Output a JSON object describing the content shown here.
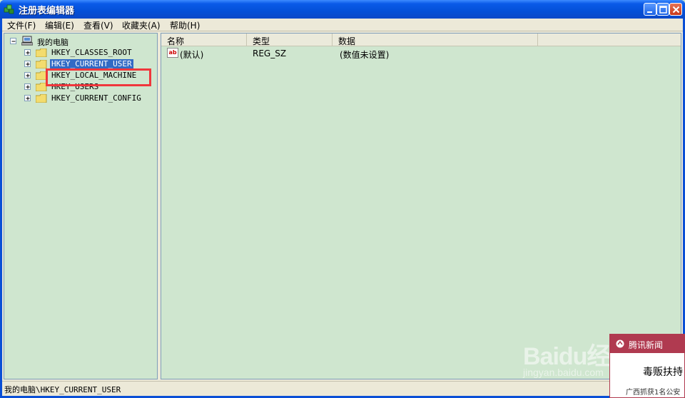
{
  "window": {
    "title": "注册表编辑器"
  },
  "menubar": {
    "items": [
      {
        "label": "文件(F)"
      },
      {
        "label": "编辑(E)"
      },
      {
        "label": "查看(V)"
      },
      {
        "label": "收藏夹(A)"
      },
      {
        "label": "帮助(H)"
      }
    ]
  },
  "tree": {
    "root": "我的电脑",
    "items": [
      {
        "label": "HKEY_CLASSES_ROOT"
      },
      {
        "label": "HKEY_CURRENT_USER",
        "selected": true
      },
      {
        "label": "HKEY_LOCAL_MACHINE"
      },
      {
        "label": "HKEY_USERS"
      },
      {
        "label": "HKEY_CURRENT_CONFIG"
      }
    ]
  },
  "list": {
    "columns": [
      "名称",
      "类型",
      "数据"
    ],
    "rows": [
      {
        "name": "(默认)",
        "type": "REG_SZ",
        "data": "(数值未设置)",
        "icon": "string-value-icon"
      }
    ]
  },
  "statusbar": {
    "path": "我的电脑\\HKEY_CURRENT_USER"
  },
  "news": {
    "header": "腾讯新闻",
    "headline": "毒贩扶持",
    "subline": "广西抓获1名公安"
  },
  "watermark": {
    "logo": "Baidu经验",
    "url": "jingyan.baidu.com"
  },
  "colors": {
    "titlebar": "#0a5ae8",
    "pane_background": "#cfe6cf",
    "highlight_box": "#f0373c",
    "selection": "#316ac5",
    "news_header": "#b03a50"
  }
}
